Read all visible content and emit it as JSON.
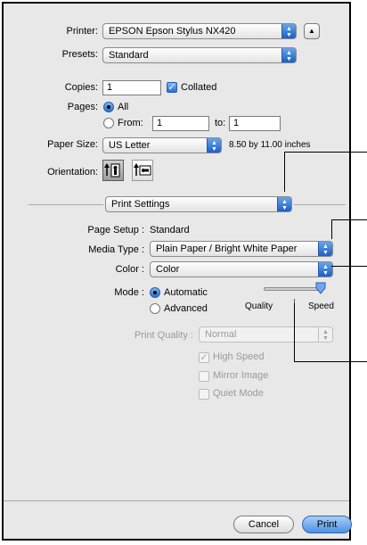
{
  "printer": {
    "label": "Printer:",
    "value": "EPSON Epson Stylus NX420"
  },
  "presets": {
    "label": "Presets:",
    "value": "Standard"
  },
  "copies": {
    "label": "Copies:",
    "value": "1",
    "collated_label": "Collated",
    "collated": true
  },
  "pages": {
    "label": "Pages:",
    "all_label": "All",
    "from_label": "From:",
    "from_value": "1",
    "to_label": "to:",
    "to_value": "1",
    "selected": "All"
  },
  "paper_size": {
    "label": "Paper Size:",
    "value": "US Letter",
    "dimensions": "8.50 by 11.00 inches"
  },
  "orientation": {
    "label": "Orientation:"
  },
  "panel_popup": {
    "value": "Print Settings"
  },
  "page_setup": {
    "label": "Page Setup :",
    "value": "Standard"
  },
  "media_type": {
    "label": "Media Type :",
    "value": "Plain Paper / Bright White Paper"
  },
  "color": {
    "label": "Color :",
    "value": "Color"
  },
  "mode": {
    "label": "Mode :",
    "automatic_label": "Automatic",
    "advanced_label": "Advanced",
    "selected": "Automatic",
    "slider_left": "Quality",
    "slider_right": "Speed",
    "slider_position": 1.0
  },
  "print_quality": {
    "label": "Print Quality :",
    "value": "Normal"
  },
  "options": {
    "high_speed": "High Speed",
    "mirror_image": "Mirror Image",
    "quiet_mode": "Quiet Mode",
    "high_speed_checked": true
  },
  "buttons": {
    "cancel": "Cancel",
    "print": "Print"
  },
  "colors": {
    "accent": "#2a6fd4",
    "dialog_bg": "#e8e8e8"
  }
}
